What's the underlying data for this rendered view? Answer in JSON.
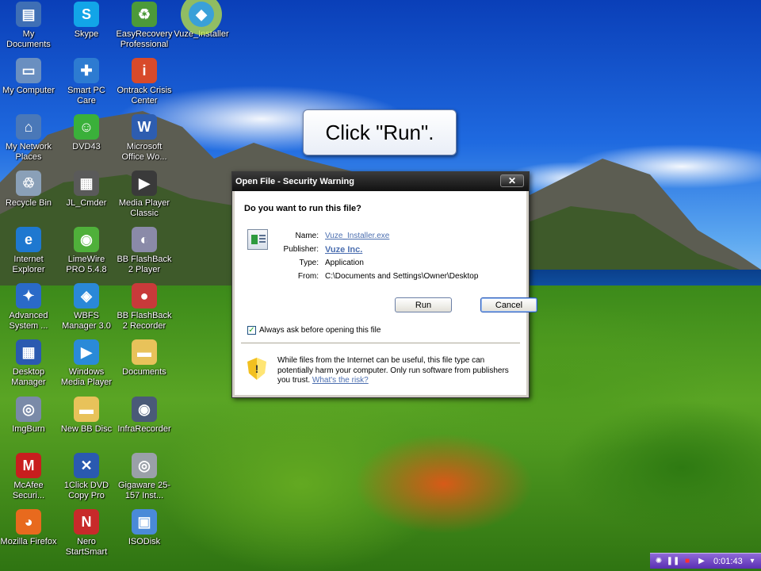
{
  "desktop_icons": [
    {
      "label": "My Documents",
      "icon": "my-documents-icon",
      "color": "#3f6fb5",
      "glyph": "▤"
    },
    {
      "label": "Skype",
      "icon": "skype-icon",
      "color": "#12a5e8",
      "glyph": "S"
    },
    {
      "label": "EasyRecovery Professional",
      "icon": "easyrecovery-icon",
      "color": "#4c9a3a",
      "glyph": "♻"
    },
    {
      "label": "Vuze_Installer",
      "icon": "vuze-installer-icon",
      "color": "#3aa0d8",
      "glyph": "◆"
    },
    {
      "label": "My Computer",
      "icon": "my-computer-icon",
      "color": "#6a8fc0",
      "glyph": "▭"
    },
    {
      "label": "Smart PC Care",
      "icon": "smart-pc-care-icon",
      "color": "#2d7bd1",
      "glyph": "✚"
    },
    {
      "label": "Ontrack Crisis Center",
      "icon": "ontrack-icon",
      "color": "#d84a2a",
      "glyph": "i"
    },
    {
      "label": "My Network Places",
      "icon": "network-places-icon",
      "color": "#4a78b8",
      "glyph": "⌂"
    },
    {
      "label": "DVD43",
      "icon": "dvd43-icon",
      "color": "#3ab03a",
      "glyph": "☺"
    },
    {
      "label": "Microsoft Office Wo...",
      "icon": "word-icon",
      "color": "#2d5db0",
      "glyph": "W"
    },
    {
      "label": "Recycle Bin",
      "icon": "recycle-bin-icon",
      "color": "#8aa0b8",
      "glyph": "♲"
    },
    {
      "label": "JL_Cmder",
      "icon": "jl-cmder-icon",
      "color": "#5a5a5a",
      "glyph": "▦"
    },
    {
      "label": "Media Player Classic",
      "icon": "media-player-classic-icon",
      "color": "#3a3a3a",
      "glyph": "▶"
    },
    {
      "label": "Internet Explorer",
      "icon": "internet-explorer-icon",
      "color": "#1e78d0",
      "glyph": "e"
    },
    {
      "label": "LimeWire PRO 5.4.8",
      "icon": "limewire-icon",
      "color": "#4fb03a",
      "glyph": "◉"
    },
    {
      "label": "BB FlashBack 2 Player",
      "icon": "bb-flashback-player-icon",
      "color": "#8a8aa8",
      "glyph": "◐"
    },
    {
      "label": "Advanced System ...",
      "icon": "advanced-system-icon",
      "color": "#2a6ac8",
      "glyph": "✦"
    },
    {
      "label": "WBFS Manager 3.0",
      "icon": "wbfs-manager-icon",
      "color": "#2a88d8",
      "glyph": "◈"
    },
    {
      "label": "BB FlashBack 2 Recorder",
      "icon": "bb-flashback-recorder-icon",
      "color": "#c83a3a",
      "glyph": "●"
    },
    {
      "label": "Desktop Manager",
      "icon": "desktop-manager-icon",
      "color": "#2a5ab0",
      "glyph": "▦"
    },
    {
      "label": "Windows Media Player",
      "icon": "windows-media-player-icon",
      "color": "#2a8ad8",
      "glyph": "▶"
    },
    {
      "label": "Documents",
      "icon": "documents-folder-icon",
      "color": "#e8c25a",
      "glyph": "▬"
    },
    {
      "label": "ImgBurn",
      "icon": "imgburn-icon",
      "color": "#7a8aa8",
      "glyph": "◎"
    },
    {
      "label": "New BB Disc",
      "icon": "new-bb-disc-folder-icon",
      "color": "#e8c25a",
      "glyph": "▬"
    },
    {
      "label": "InfraRecorder",
      "icon": "infrarecorder-icon",
      "color": "#4a5a78",
      "glyph": "◉"
    },
    {
      "label": "McAfee Securi...",
      "icon": "mcafee-icon",
      "color": "#c81e1e",
      "glyph": "M"
    },
    {
      "label": "1Click DVD Copy Pro",
      "icon": "1click-dvd-icon",
      "color": "#2a5ab0",
      "glyph": "✕"
    },
    {
      "label": "Gigaware 25-157 Inst...",
      "icon": "gigaware-icon",
      "color": "#9aa0a8",
      "glyph": "◎"
    },
    {
      "label": "Mozilla Firefox",
      "icon": "firefox-icon",
      "color": "#e86a1e",
      "glyph": "◕"
    },
    {
      "label": "Nero StartSmart",
      "icon": "nero-icon",
      "color": "#c82a2a",
      "glyph": "N"
    },
    {
      "label": "ISODisk",
      "icon": "isodisk-icon",
      "color": "#4a8ad8",
      "glyph": "▣"
    }
  ],
  "callout": {
    "text": "Click \"Run\"."
  },
  "dialog": {
    "title": "Open File - Security Warning",
    "close_glyph": "✕",
    "question": "Do you want to run this file?",
    "properties": [
      {
        "label": "Name:",
        "value": "Vuze_Installer.exe",
        "style": "link"
      },
      {
        "label": "Publisher:",
        "value": "Vuze Inc.",
        "style": "link-bold"
      },
      {
        "label": "Type:",
        "value": "Application",
        "style": "plain"
      },
      {
        "label": "From:",
        "value": "C:\\Documents and Settings\\Owner\\Desktop",
        "style": "plain"
      }
    ],
    "run_label": "Run",
    "cancel_label": "Cancel",
    "checkbox_label": "Always ask before opening this file",
    "checkbox_checked": true,
    "warning_text": "While files from the Internet can be useful, this file type can potentially harm your computer. Only run software from publishers you trust.",
    "risk_link": "What's the risk?"
  },
  "media_bar": {
    "time": "0:01:43"
  }
}
